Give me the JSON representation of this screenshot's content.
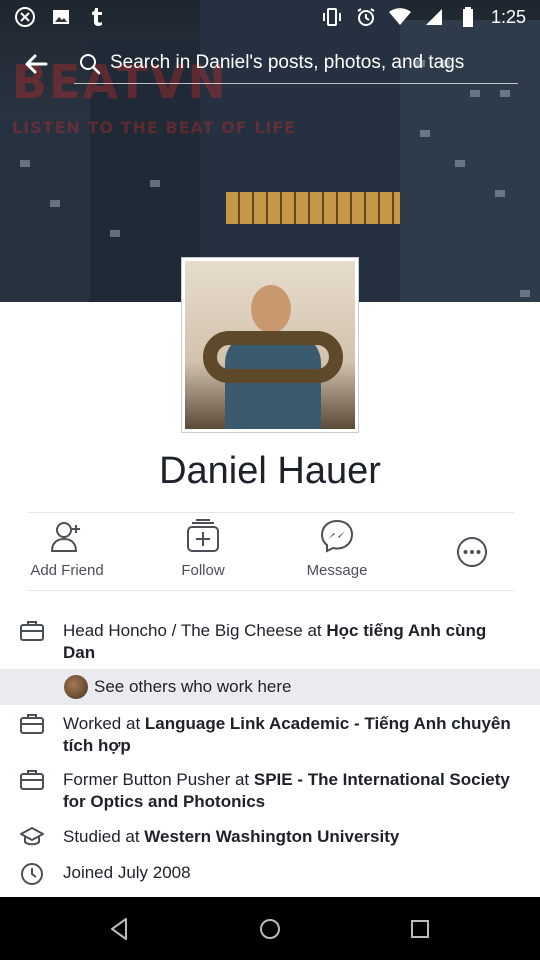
{
  "status_bar": {
    "time": "1:25",
    "left_icons": [
      "hangouts-icon",
      "image-icon",
      "tumblr-icon"
    ],
    "right_icons": [
      "vibrate-icon",
      "alarm-icon",
      "wifi-icon",
      "signal-icon",
      "battery-icon"
    ]
  },
  "cover": {
    "watermark": "BEATVN",
    "watermark_sub": "LISTEN TO THE BEAT OF LIFE"
  },
  "search": {
    "text": "Search in Daniel's posts, photos, and tags"
  },
  "profile": {
    "name": "Daniel Hauer"
  },
  "actions": [
    {
      "label": "Add Friend",
      "icon": "add-friend-icon"
    },
    {
      "label": "Follow",
      "icon": "follow-icon"
    },
    {
      "label": "Message",
      "icon": "messenger-icon"
    },
    {
      "label": "",
      "icon": "more-icon"
    }
  ],
  "about": {
    "work1_prefix": "Head Honcho / The Big Cheese at ",
    "work1_place": "Học tiếng Anh cùng Dan",
    "see_others": "See others who work here",
    "work2_prefix": "Worked at ",
    "work2_place": "Language Link Academic - Tiếng Anh chuyên tích hợp",
    "work3_prefix": "Former Button Pusher at ",
    "work3_place": "SPIE - The International Society for Optics and Photonics",
    "edu_prefix": "Studied at ",
    "edu_place": "Western Washington University",
    "joined": "Joined July 2008"
  },
  "colors": {
    "accent": "#4b4f56",
    "divider": "#e4e6eb",
    "highlight_row": "#e9ebee",
    "watermark": "#d42a2a"
  }
}
